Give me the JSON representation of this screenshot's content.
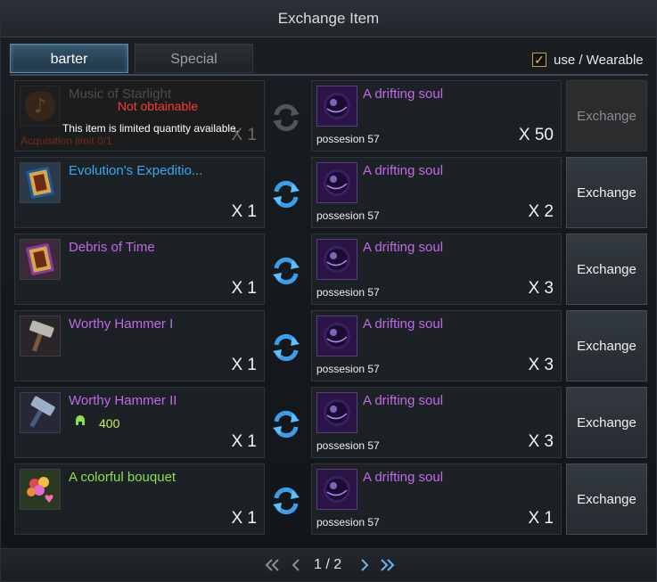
{
  "window": {
    "title": "Exchange Item"
  },
  "tabs": [
    {
      "label": "barter",
      "active": true
    },
    {
      "label": "Special",
      "active": false
    }
  ],
  "filter": {
    "label": "use / Wearable",
    "checked": true,
    "check_glyph": "✓"
  },
  "colors": {
    "name_purple": "#c169e6",
    "name_blue": "#3aa8f0",
    "name_green": "#8ce04a",
    "not_obtainable": "#ff3b2f"
  },
  "rows": [
    {
      "give_name": "Music of Starlight",
      "give_qty": "X 1",
      "get_name": "A drifting soul",
      "get_possession": "possesion 57",
      "get_qty": "X 50",
      "button": "Exchange",
      "disabled": true,
      "not_obtainable": "Not obtainable",
      "limited_text": "This item is limited quantity available.",
      "acquisition_text": "Acquisition limit 0/1",
      "icon": "music-note-icon"
    },
    {
      "give_name": "Evolution's Expeditio...",
      "give_qty": "X 1",
      "get_name": "A drifting soul",
      "get_possession": "possesion 57",
      "get_qty": "X 2",
      "button": "Exchange",
      "icon": "card-icon"
    },
    {
      "give_name": "Debris of Time",
      "give_qty": "X 1",
      "get_name": "A drifting soul",
      "get_possession": "possesion 57",
      "get_qty": "X 3",
      "button": "Exchange",
      "icon": "card-icon"
    },
    {
      "give_name": "Worthy Hammer I",
      "give_qty": "X 1",
      "get_name": "A drifting soul",
      "get_possession": "possesion 57",
      "get_qty": "X 3",
      "button": "Exchange",
      "icon": "hammer-icon"
    },
    {
      "give_name": "Worthy Hammer II",
      "give_qty": "X 1",
      "give_price": "400",
      "get_name": "A drifting soul",
      "get_possession": "possesion 57",
      "get_qty": "X 3",
      "button": "Exchange",
      "icon": "hammer-icon"
    },
    {
      "give_name": "A colorful bouquet",
      "give_qty": "X 1",
      "get_name": "A drifting soul",
      "get_possession": "possesion 57",
      "get_qty": "X 1",
      "button": "Exchange",
      "icon": "bouquet-icon"
    }
  ],
  "pager": {
    "text": "1 / 2"
  }
}
